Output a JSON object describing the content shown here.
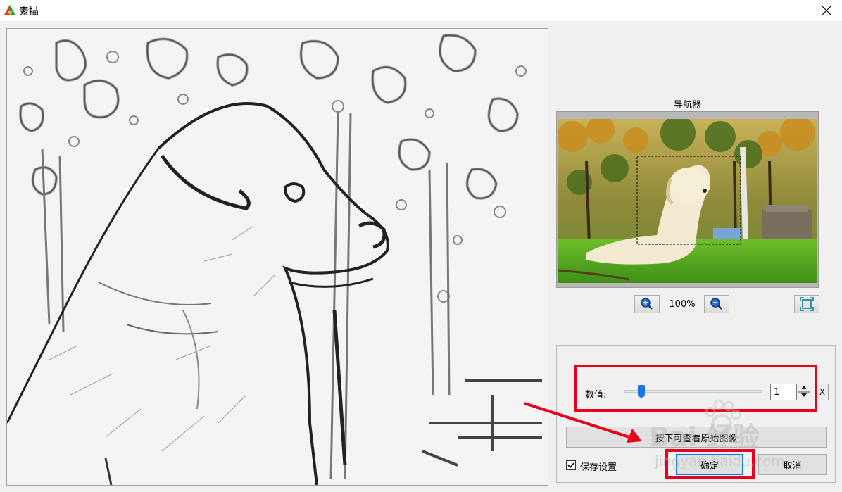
{
  "window": {
    "title": "素描",
    "close_label": "×"
  },
  "navigator": {
    "title": "导航器",
    "zoom_level": "100%"
  },
  "settings": {
    "value_label": "数值:",
    "value": "1",
    "slider_fraction": 0.1,
    "reset_label": "X",
    "hold_button_label": "按下可查看原始图像",
    "save_settings_label": "保存设置",
    "save_settings_checked": true,
    "ok_label": "确定",
    "cancel_label": "取消"
  },
  "watermark": {
    "text": "Bai 经验",
    "url": "jingyan.baidu.com"
  },
  "colors": {
    "highlight": "#e8001c",
    "accent": "#1a73e8"
  }
}
